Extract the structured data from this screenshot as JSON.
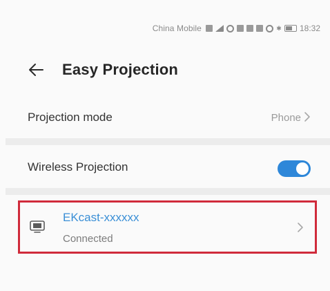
{
  "status_bar": {
    "carrier": "China Mobile",
    "time": "18:32"
  },
  "header": {
    "back_icon": "arrow-left-icon",
    "title": "Easy Projection"
  },
  "projection_mode": {
    "label": "Projection mode",
    "value": "Phone"
  },
  "wireless_projection": {
    "label": "Wireless Projection",
    "enabled": true,
    "toggle_color": "#2e87d9"
  },
  "device": {
    "name": "EKcast-xxxxxx",
    "status": "Connected",
    "icon": "cast-screen-icon",
    "highlight_color": "#d02b3b",
    "name_color": "#3a8fd6"
  }
}
